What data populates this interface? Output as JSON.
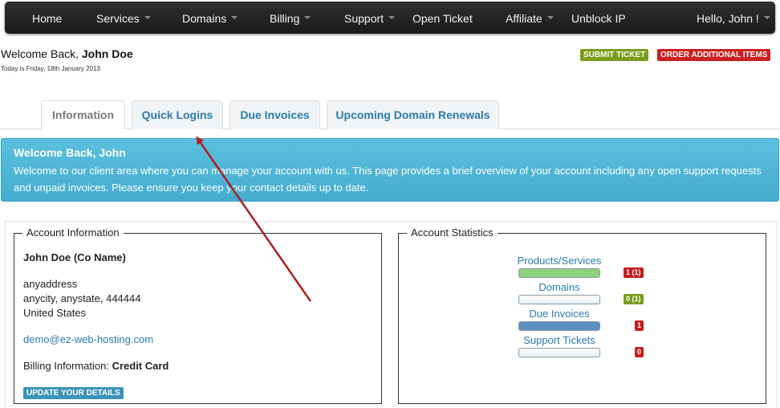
{
  "nav": {
    "home": "Home",
    "services": "Services",
    "domains": "Domains",
    "billing": "Billing",
    "support": "Support",
    "open_ticket": "Open Ticket",
    "affiliate": "Affiliate",
    "unblock_ip": "Unblock IP",
    "user_menu": "Hello, John !"
  },
  "header": {
    "welcome_prefix": "Welcome Back,",
    "user_name": "John Doe",
    "date_text": "Today is Friday, 18th January 2013",
    "submit_ticket": "SUBMIT TICKET",
    "order_items": "ORDER ADDITIONAL ITEMS"
  },
  "tabs": [
    {
      "label": "Information",
      "active": true
    },
    {
      "label": "Quick Logins",
      "active": false
    },
    {
      "label": "Due Invoices",
      "active": false
    },
    {
      "label": "Upcoming Domain Renewals",
      "active": false
    }
  ],
  "alert": {
    "title": "Welcome Back, John",
    "text": "Welcome to our client area where you can manage your account with us. This page provides a brief overview of your account including any open support requests and unpaid invoices. Please ensure you keep your contact details up to date."
  },
  "account": {
    "legend": "Account Information",
    "name": "John Doe (Co Name)",
    "address1": "anyaddress",
    "address2": "anycity, anystate, 444444",
    "country": "United States",
    "email": "demo@ez-web-hosting.com",
    "billing_label": "Billing Information:",
    "billing_value": "Credit Card",
    "update_button": "UPDATE YOUR DETAILS"
  },
  "stats": {
    "legend": "Account Statistics",
    "items": [
      {
        "label": "Products/Services",
        "badge": "1 (1)",
        "fill": 1.0,
        "bar_color": "#8fd07a",
        "badge_color": "#c41e1e"
      },
      {
        "label": "Domains",
        "badge": "0 (1)",
        "fill": 0.0,
        "bar_color": "#8fd07a",
        "badge_color": "#7a9c1b"
      },
      {
        "label": "Due Invoices",
        "badge": "1",
        "fill": 1.0,
        "bar_color": "#5b8fbf",
        "badge_color": "#c41e1e"
      },
      {
        "label": "Support Tickets",
        "badge": "0",
        "fill": 0.0,
        "bar_color": "#5b8fbf",
        "badge_color": "#c41e1e"
      }
    ]
  },
  "colors": {
    "accent_link": "#2a7bb0",
    "alert_bg": "#4eb6d7",
    "annotation_arrow": "#b01e1e"
  }
}
